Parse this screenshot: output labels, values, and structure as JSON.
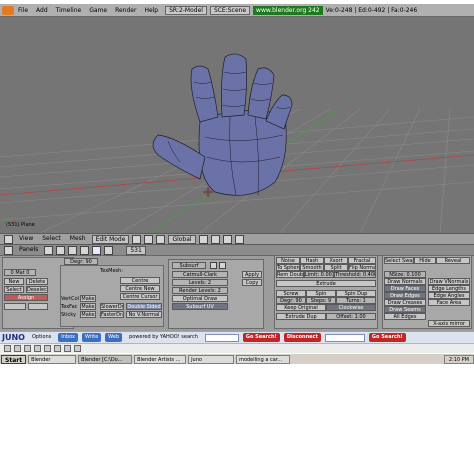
{
  "menubar": {
    "items": [
      "File",
      "Add",
      "Timeline",
      "Game",
      "Render",
      "Help"
    ],
    "screen": "SR:2-Model",
    "scene": "SCE:Scene",
    "url": "www.blender.org 242",
    "stats": "Ve:0-248 | Ed:0-492 | Fa:0-246"
  },
  "viewport": {
    "object_label": "(531) Plane",
    "colors": {
      "bg": "#757575",
      "grid": "#8a8a8a",
      "mesh": "#6b72a8",
      "wire": "#1d1d2a",
      "axis_x": "#c44",
      "axis_y": "#4a4"
    }
  },
  "viewheader": {
    "view": "View",
    "select": "Select",
    "mesh": "Mesh",
    "mode": "Edit Mode",
    "orientation": "Global"
  },
  "buttons": {
    "header": {
      "panels": "Panels",
      "frame": "531"
    },
    "link": {
      "me": "ME:Mesh",
      "ob": "OB:Plane",
      "mat": "0 Mat 0",
      "new": "New",
      "delete": "Delete",
      "select": "Select",
      "deselect": "Deselect",
      "assign": "Assign",
      "degr": "Degr: 90",
      "texmesh": "TexMesh:"
    },
    "mesh": {
      "centre": "Centre",
      "centre_new": "Centre New",
      "centre_cursor": "Centre Cursor",
      "vertcol": "VertCol",
      "texface": "TexFac",
      "sticky": "Sticky",
      "make": "Make",
      "slowerdraw": "SlowerDr",
      "fasterdraw": "FasterDra",
      "double_sided": "Double Sided",
      "no_v_normal": "No V.Normal"
    },
    "modifiers": {
      "name": "Subsurf",
      "type": "Catmull-Clark",
      "levels": "Levels: 2",
      "render_levels": "Render Levels: 2",
      "optimal": "Optimal Draw",
      "subsurf_uv": "Subsurf UV",
      "apply": "Apply",
      "copy": "Copy"
    },
    "tools": {
      "noise": "Noise",
      "hash": "Hash",
      "xsort": "Xsort",
      "fractal": "Fractal",
      "to_sphere": "To Sphere",
      "smooth": "Smooth",
      "split": "Split",
      "flip_normal": "Flip Normal",
      "rem_doubles": "Rem Doubles",
      "limit": "Limit: 0.001",
      "threshold": "Threshold: 0.400",
      "extrude": "Extrude",
      "screw": "Screw",
      "spin": "Spin",
      "spin_dup": "Spin Dup",
      "degr": "Degr: 90",
      "steps": "Steps: 9",
      "turns": "Turns: 1",
      "keep_original": "Keep Original",
      "clockwise": "Clockwise",
      "extrude_dup": "Extrude Dup",
      "offset": "Offset: 1.00"
    },
    "draw": {
      "select_swap": "Select Swap",
      "hide": "Hide",
      "reveal": "Reveal",
      "nsize": "NSize: 0.100",
      "draw_normals": "Draw Normals",
      "draw_vnormals": "Draw VNormals",
      "draw_faces": "Draw Faces",
      "edge_lengths": "Edge Lengths",
      "draw_edges": "Draw Edges",
      "edge_angles": "Edge Angles",
      "draw_creases": "Draw Creases",
      "face_area": "Face Area",
      "draw_seams": "Draw Seams",
      "all_edges": "All Edges",
      "x_axis_mirror": "X-axis mirror"
    }
  },
  "juno": {
    "logo": "JUNO",
    "options": "Options",
    "inbox": "Inbox",
    "write": "Write",
    "web": "Web",
    "powered": "powered by YAHOO! search",
    "go_search": "Go Search!",
    "disconnect": "Disconnect",
    "go_search2": "Go Search!"
  },
  "taskbar": {
    "start": "Start",
    "tasks": [
      "Blender",
      "Blender [C:\\Do...",
      "Blender Artists ...",
      "Juno",
      "modelling a car..."
    ],
    "clock": "2:10 PM"
  }
}
